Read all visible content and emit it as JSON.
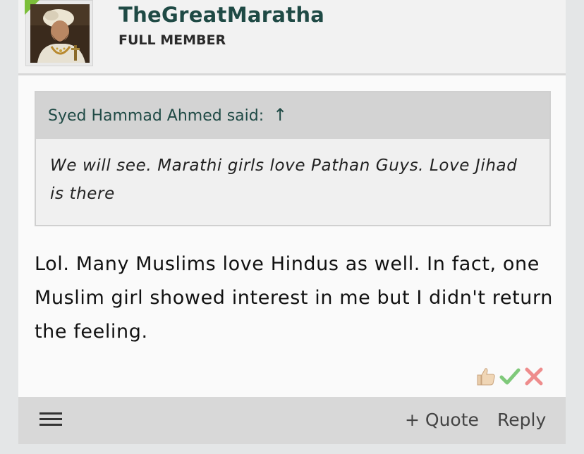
{
  "author": {
    "username": "TheGreatMaratha",
    "title": "FULL MEMBER"
  },
  "quote": {
    "author_label": "Syed Hammad Ahmed said:",
    "arrow_glyph": "↑",
    "text": "We will see. Marathi girls love Pathan Guys. Love Jihad is there"
  },
  "message": {
    "text": "Lol. Many Muslims love Hindus as well. In fact, one Muslim girl showed interest in me but I didn't return the feeling."
  },
  "reactions": [
    {
      "name": "like",
      "icon": "thumbs-up-icon"
    },
    {
      "name": "agree",
      "icon": "check-icon"
    },
    {
      "name": "disagree",
      "icon": "x-icon"
    }
  ],
  "footer": {
    "quote_label": "+ Quote",
    "reply_label": "Reply"
  },
  "colors": {
    "username": "#1f4a45",
    "online": "#7cbf3a",
    "check": "#7fc97a",
    "x": "#ee8c8c"
  }
}
